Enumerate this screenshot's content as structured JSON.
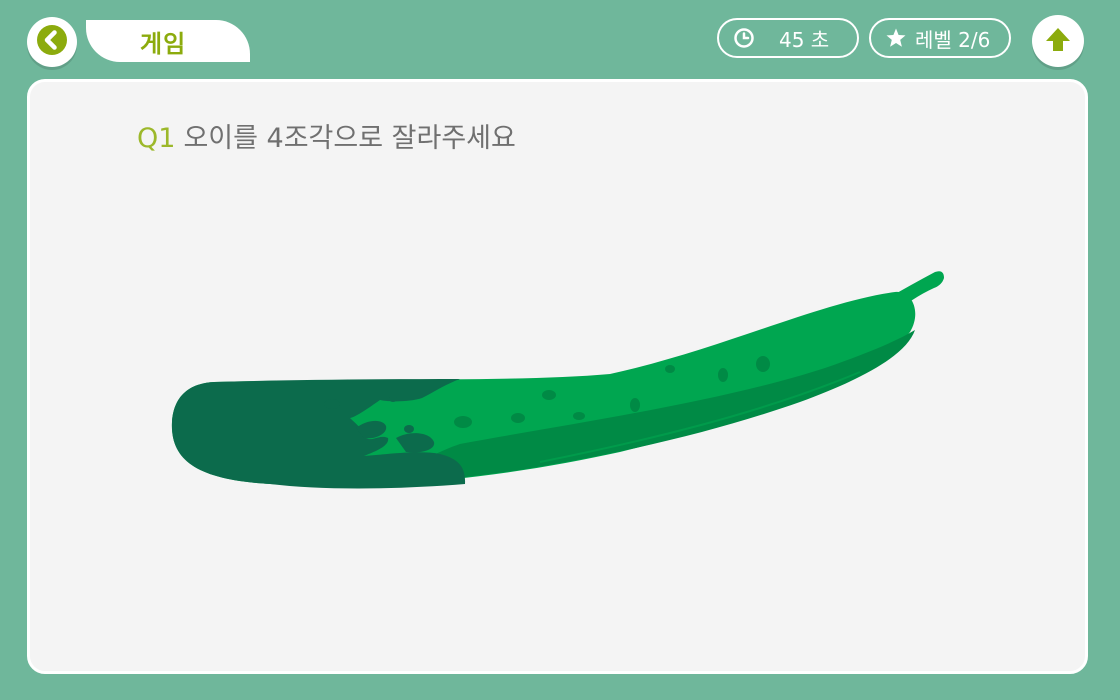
{
  "header": {
    "back_icon": "chevron-left-icon",
    "title": "게임",
    "timer": {
      "icon": "clock-icon",
      "text": "45 초"
    },
    "level": {
      "icon": "star-icon",
      "text": "레벨 2/6"
    },
    "home_icon": "arrow-up-icon"
  },
  "question": {
    "number": "Q1",
    "text": "오이를 4조각으로 잘라주세요"
  },
  "illustration": {
    "name": "cucumber"
  },
  "colors": {
    "background": "#6fb79b",
    "accent": "#8cab0d",
    "question_number": "#9cb82a",
    "cucumber_light": "#00a650",
    "cucumber_dark": "#0c6b4c",
    "cucumber_mid": "#008a45"
  }
}
